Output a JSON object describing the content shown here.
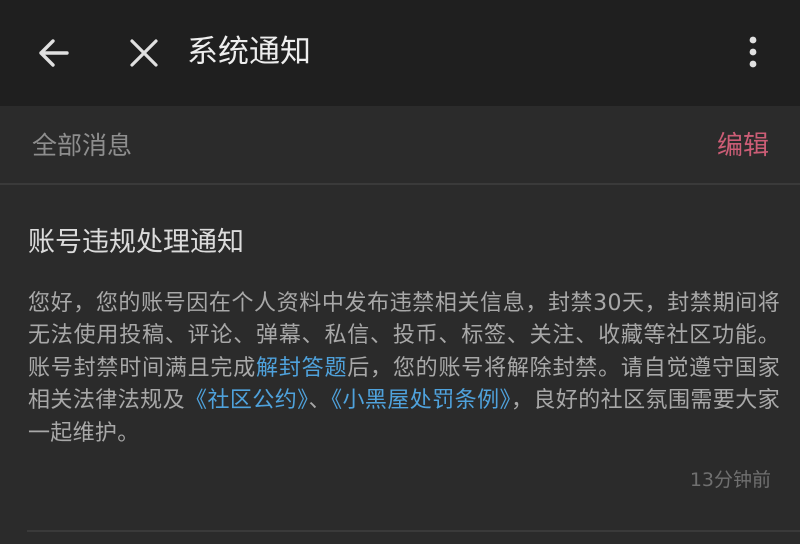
{
  "header": {
    "title": "系统通知",
    "back_icon": "arrow-left-icon",
    "close_icon": "close-icon",
    "more_icon": "more-vertical-icon"
  },
  "filter": {
    "label": "全部消息",
    "edit_label": "编辑"
  },
  "message": {
    "title": "账号违规处理通知",
    "body_part1": "您好，您的账号因在个人资料中发布违禁相关信息，封禁30天，封禁期间将无法使用投稿、评论、弹幕、私信、投币、标签、关注、收藏等社区功能。账号封禁时间满且完成",
    "link_unban": "解封答题",
    "body_part2": "后，您的账号将解除封禁。请自觉遵守国家相关法律法规及",
    "link_convention": "《社区公约》",
    "body_part3": "、",
    "link_penalty": "《小黑屋处罚条例》",
    "body_part4": "，良好的社区氛围需要大家一起维护。",
    "timestamp": "13分钟前"
  },
  "colors": {
    "topbar_bg": "#1f1f1f",
    "page_bg": "#2b2b2b",
    "accent_pink": "#cc5d76",
    "link_blue": "#4fa2dc"
  }
}
